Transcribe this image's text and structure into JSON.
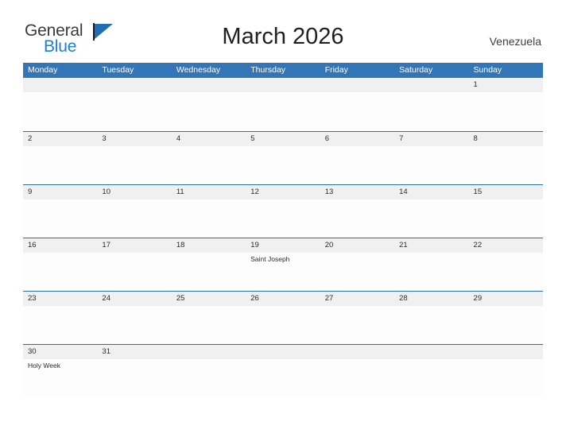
{
  "brand": {
    "word_one": "General",
    "word_two": "Blue",
    "accent_color": "#1a7fd4",
    "flag_color": "#1f6eb5"
  },
  "header": {
    "title": "March 2026",
    "region": "Venezuela"
  },
  "calendar": {
    "header_bg": "#3276b8",
    "band_bg": "#f0f0f0",
    "rule_color": "#2e6da4",
    "weekdays": [
      "Monday",
      "Tuesday",
      "Wednesday",
      "Thursday",
      "Friday",
      "Saturday",
      "Sunday"
    ],
    "weeks": [
      {
        "days": [
          {
            "num": "",
            "events": []
          },
          {
            "num": "",
            "events": []
          },
          {
            "num": "",
            "events": []
          },
          {
            "num": "",
            "events": []
          },
          {
            "num": "",
            "events": []
          },
          {
            "num": "",
            "events": []
          },
          {
            "num": "1",
            "events": []
          }
        ]
      },
      {
        "days": [
          {
            "num": "2",
            "events": []
          },
          {
            "num": "3",
            "events": []
          },
          {
            "num": "4",
            "events": []
          },
          {
            "num": "5",
            "events": []
          },
          {
            "num": "6",
            "events": []
          },
          {
            "num": "7",
            "events": []
          },
          {
            "num": "8",
            "events": []
          }
        ]
      },
      {
        "days": [
          {
            "num": "9",
            "events": []
          },
          {
            "num": "10",
            "events": []
          },
          {
            "num": "11",
            "events": []
          },
          {
            "num": "12",
            "events": []
          },
          {
            "num": "13",
            "events": []
          },
          {
            "num": "14",
            "events": []
          },
          {
            "num": "15",
            "events": []
          }
        ]
      },
      {
        "days": [
          {
            "num": "16",
            "events": []
          },
          {
            "num": "17",
            "events": []
          },
          {
            "num": "18",
            "events": []
          },
          {
            "num": "19",
            "events": [
              "Saint Joseph"
            ]
          },
          {
            "num": "20",
            "events": []
          },
          {
            "num": "21",
            "events": []
          },
          {
            "num": "22",
            "events": []
          }
        ]
      },
      {
        "days": [
          {
            "num": "23",
            "events": []
          },
          {
            "num": "24",
            "events": []
          },
          {
            "num": "25",
            "events": []
          },
          {
            "num": "26",
            "events": []
          },
          {
            "num": "27",
            "events": []
          },
          {
            "num": "28",
            "events": []
          },
          {
            "num": "29",
            "events": []
          }
        ]
      },
      {
        "days": [
          {
            "num": "30",
            "events": [
              "Holy Week"
            ]
          },
          {
            "num": "31",
            "events": []
          },
          {
            "num": "",
            "events": []
          },
          {
            "num": "",
            "events": []
          },
          {
            "num": "",
            "events": []
          },
          {
            "num": "",
            "events": []
          },
          {
            "num": "",
            "events": []
          }
        ]
      }
    ]
  }
}
